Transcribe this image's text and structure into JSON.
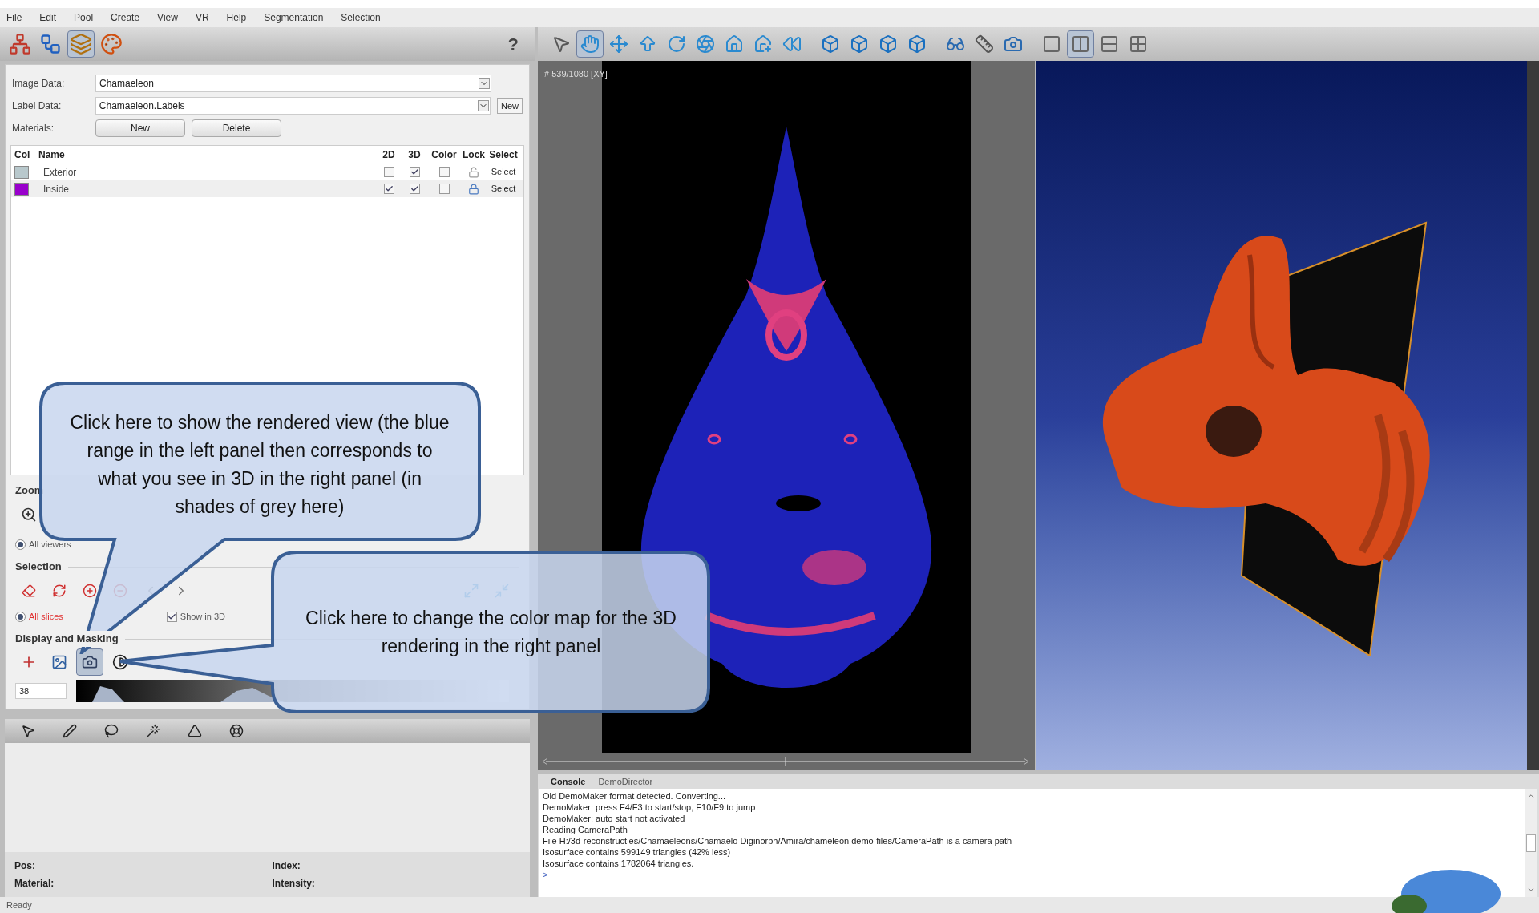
{
  "menu": [
    "File",
    "Edit",
    "Pool",
    "Create",
    "View",
    "VR",
    "Help",
    "Segmentation",
    "Selection"
  ],
  "left_toolbar": {
    "tools": [
      {
        "selected": false
      },
      {
        "selected": false
      },
      {
        "selected": true
      },
      {
        "selected": false
      }
    ],
    "help": "?"
  },
  "form": {
    "image_data": {
      "label": "Image Data:",
      "value": "Chamaeleon"
    },
    "label_data": {
      "label": "Label Data:",
      "value": "Chamaeleon.Labels",
      "button": "New"
    },
    "materials": {
      "label": "Materials:",
      "buttons": [
        "New",
        "Delete"
      ]
    }
  },
  "materials_table": {
    "columns": [
      "Col",
      "Name",
      "2D",
      "3D",
      "Color",
      "Lock",
      "Select"
    ],
    "rows": [
      {
        "color": "#b8c8cc",
        "name": "Exterior",
        "show_2d": false,
        "show_3d": true,
        "color_on": false,
        "locked": false,
        "select": "Select"
      },
      {
        "color": "#9900cc",
        "name": "Inside",
        "show_2d": true,
        "show_3d": true,
        "color_on": false,
        "locked": true,
        "select": "Select"
      }
    ]
  },
  "zoom_section": {
    "title": "Zoom",
    "radios": [
      {
        "label": "All viewers",
        "selected": true
      }
    ]
  },
  "selection_section": {
    "title": "Selection",
    "radios": [
      {
        "label": "All slices",
        "selected": true
      }
    ],
    "checkbox": {
      "label": "Show in 3D",
      "checked": true
    }
  },
  "display_section": {
    "title": "Display and Masking",
    "tools": [
      {
        "selected": false
      },
      {
        "selected": false
      },
      {
        "selected": true
      },
      {
        "selected": false
      }
    ],
    "low_value": "38"
  },
  "info": {
    "pos": "Pos:",
    "index": "Index:",
    "material": "Material:",
    "intensity": "Intensity:"
  },
  "viewer_toolbar": {
    "tools": [
      {
        "selected": false
      },
      {
        "selected": true
      },
      {
        "selected": false
      },
      {
        "selected": false
      },
      {
        "selected": false
      },
      {
        "selected": false
      },
      {
        "selected": false
      },
      {
        "selected": false
      },
      {
        "selected": false
      }
    ],
    "layouts": [
      {
        "selected": false
      },
      {
        "selected": true
      },
      {
        "selected": false
      },
      {
        "selected": false
      }
    ]
  },
  "viewer_2d": {
    "slice_label": "# 539/1080 [XY]"
  },
  "console": {
    "tabs": [
      {
        "label": "Console",
        "selected": true
      },
      {
        "label": "DemoDirector",
        "selected": false
      }
    ],
    "lines": [
      "Old DemoMaker format detected. Converting...",
      "DemoMaker: press F4/F3 to start/stop, F10/F9 to jump",
      "DemoMaker: auto start not activated",
      "Reading CameraPath",
      "File H:/3d-reconstructies/Chamaeleons/Chamaelo Diginorph/Amira/chameleon demo-files/CameraPath is a camera path",
      "Isosurface contains 599149 triangles (42% less)",
      "Isosurface contains 1782064 triangles.",
      ">"
    ]
  },
  "status_bar": "Ready",
  "callouts": [
    {
      "text": "Click here to show the rendered view (the blue range in the left panel then corresponds to what you see in 3D in the right panel (in shades of grey here)"
    },
    {
      "text": "Click here to change the color map for the 3D rendering in the right panel"
    }
  ]
}
